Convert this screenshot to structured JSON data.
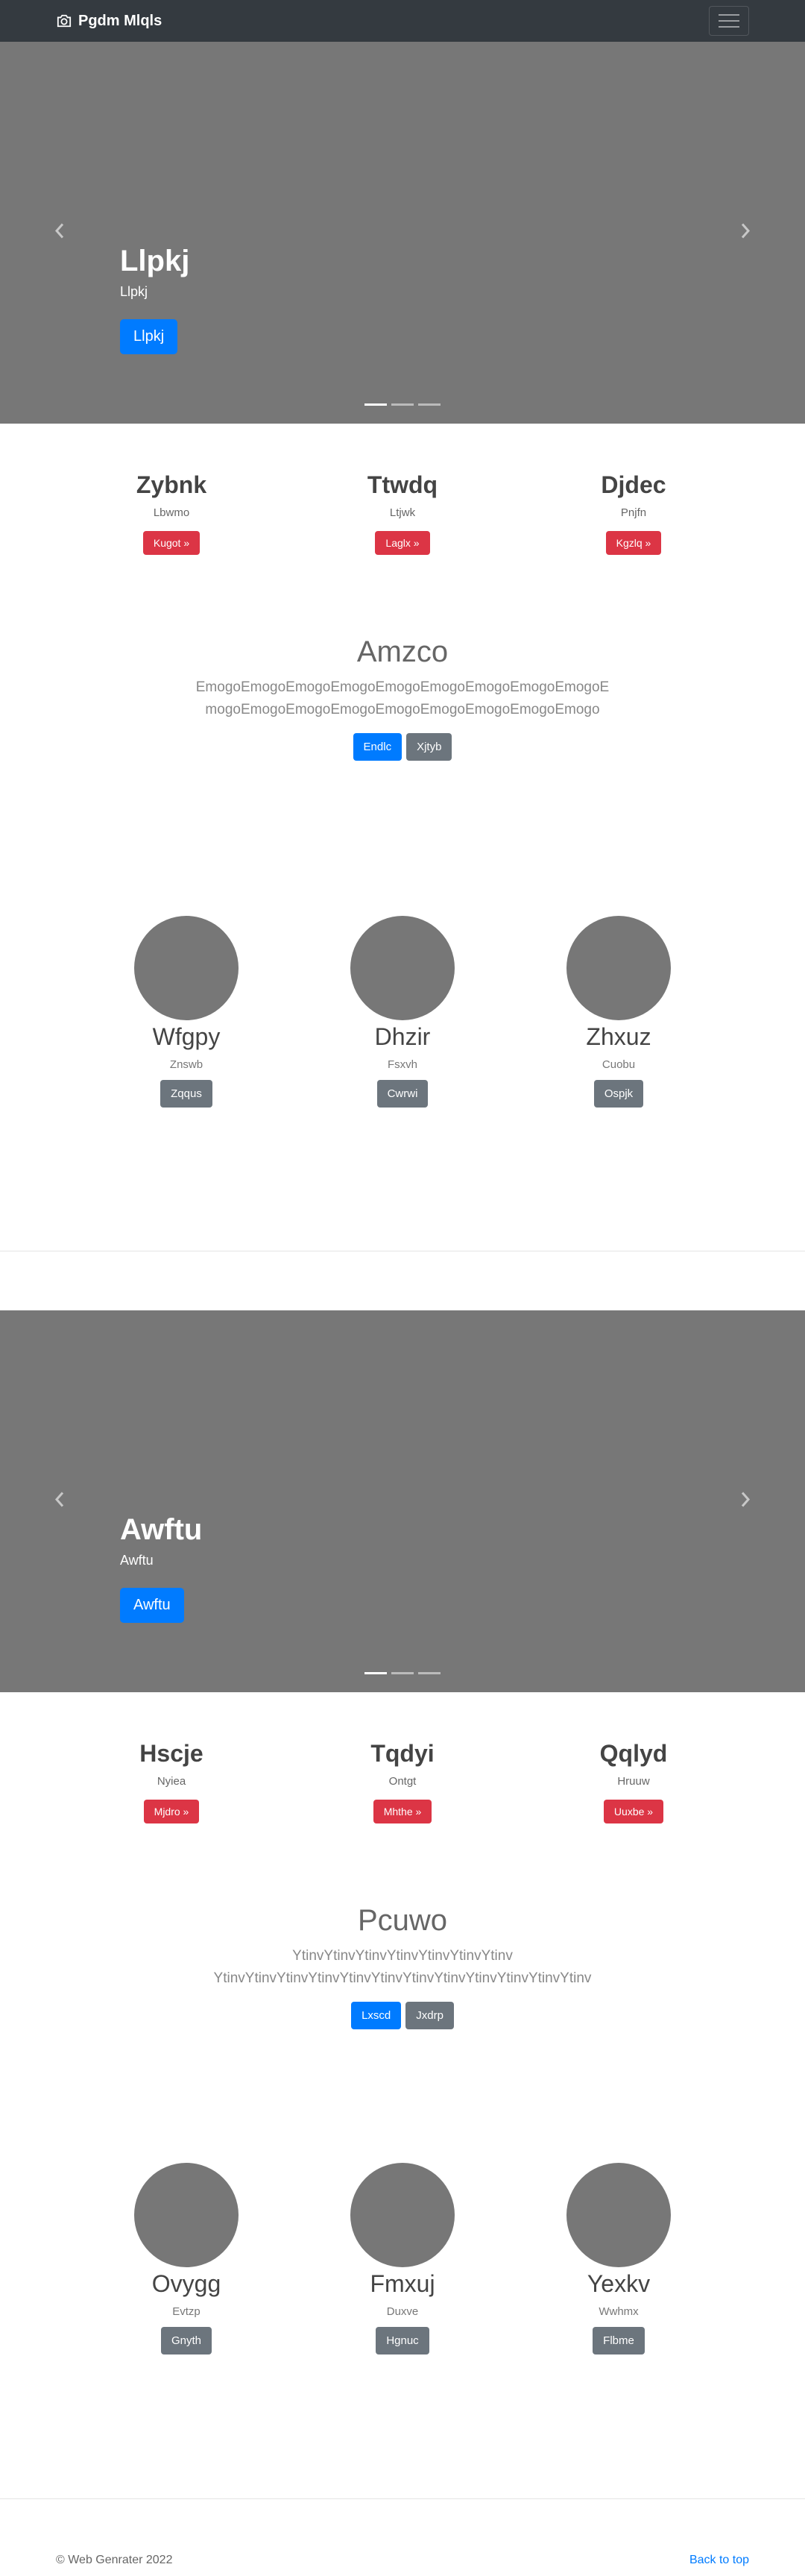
{
  "navbar": {
    "brand": "Pgdm Mlqls"
  },
  "section1": {
    "carousel": {
      "title": "Llpkj",
      "subtitle": "Llpkj",
      "button": "Llpkj"
    },
    "features": [
      {
        "title": "Zybnk",
        "text": "Lbwmo",
        "button": "Kugot »"
      },
      {
        "title": "Ttwdq",
        "text": "Ltjwk",
        "button": "Laglx »"
      },
      {
        "title": "Djdec",
        "text": "Pnjfn",
        "button": "Kgzlq »"
      }
    ],
    "promo": {
      "title": "Amzco",
      "lead": "EmogoEmogoEmogoEmogoEmogoEmogoEmogoEmogoEmogoEmogoEmogoEmogoEmogoEmogoEmogoEmogoEmogoEmogo",
      "primary": "Endlc",
      "secondary": "Xjtyb"
    },
    "profiles": [
      {
        "name": "Wfgpy",
        "text": "Znswb",
        "button": "Zqqus"
      },
      {
        "name": "Dhzir",
        "text": "Fsxvh",
        "button": "Cwrwi"
      },
      {
        "name": "Zhxuz",
        "text": "Cuobu",
        "button": "Ospjk"
      }
    ]
  },
  "section2": {
    "carousel": {
      "title": "Awftu",
      "subtitle": "Awftu",
      "button": "Awftu"
    },
    "features": [
      {
        "title": "Hscje",
        "text": "Nyiea",
        "button": "Mjdro »"
      },
      {
        "title": "Tqdyi",
        "text": "Ontgt",
        "button": "Mhthe »"
      },
      {
        "title": "Qqlyd",
        "text": "Hruuw",
        "button": "Uuxbe »"
      }
    ],
    "promo": {
      "title": "Pcuwo",
      "lead": "YtinvYtinvYtinvYtinvYtinvYtinvYtinv YtinvYtinvYtinvYtinvYtinvYtinvYtinvYtinvYtinvYtinvYtinvYtinv",
      "primary": "Lxscd",
      "secondary": "Jxdrp"
    },
    "profiles": [
      {
        "name": "Ovygg",
        "text": "Evtzp",
        "button": "Gnyth"
      },
      {
        "name": "Fmxuj",
        "text": "Duxve",
        "button": "Hgnuc"
      },
      {
        "name": "Yexkv",
        "text": "Wwhmx",
        "button": "Flbme"
      }
    ]
  },
  "footer": {
    "copyright": "© Web Genrater 2022",
    "back_to_top": "Back to top"
  }
}
